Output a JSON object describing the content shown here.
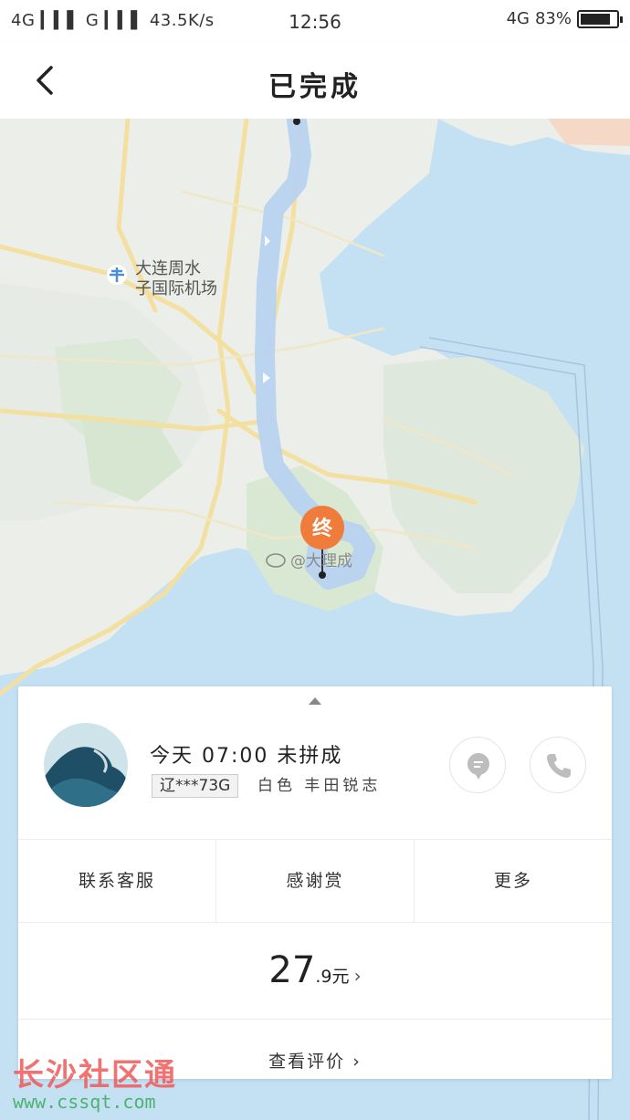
{
  "status_bar": {
    "signal": "4G",
    "signal2": "G",
    "speed": "43.5K/s",
    "time": "12:56",
    "network": "4G",
    "battery": "83%",
    "battery_level": 0.83
  },
  "nav": {
    "title": "已完成"
  },
  "map": {
    "poi_airport_line1": "大连周水",
    "poi_airport_line2": "子国际机场",
    "end_marker": "终",
    "weibo_watermark": "@大理成"
  },
  "trip": {
    "day": "今天",
    "time": "07:00",
    "status": "未拼成",
    "plate": "辽***73G",
    "car": "白色 丰田锐志"
  },
  "actions": [
    "联系客服",
    "感谢赏",
    "更多"
  ],
  "fare": {
    "integer": "27",
    "decimal": ".9元",
    "arrow": "›"
  },
  "review": "查看评价 ›",
  "watermark": {
    "cn": "长沙社区通",
    "url": "www.cssqt.com"
  },
  "colors": {
    "route": "#b8d2ef",
    "end_marker": "#f07c3c",
    "water": "#b9dcf2",
    "land": "#edf0ec"
  }
}
